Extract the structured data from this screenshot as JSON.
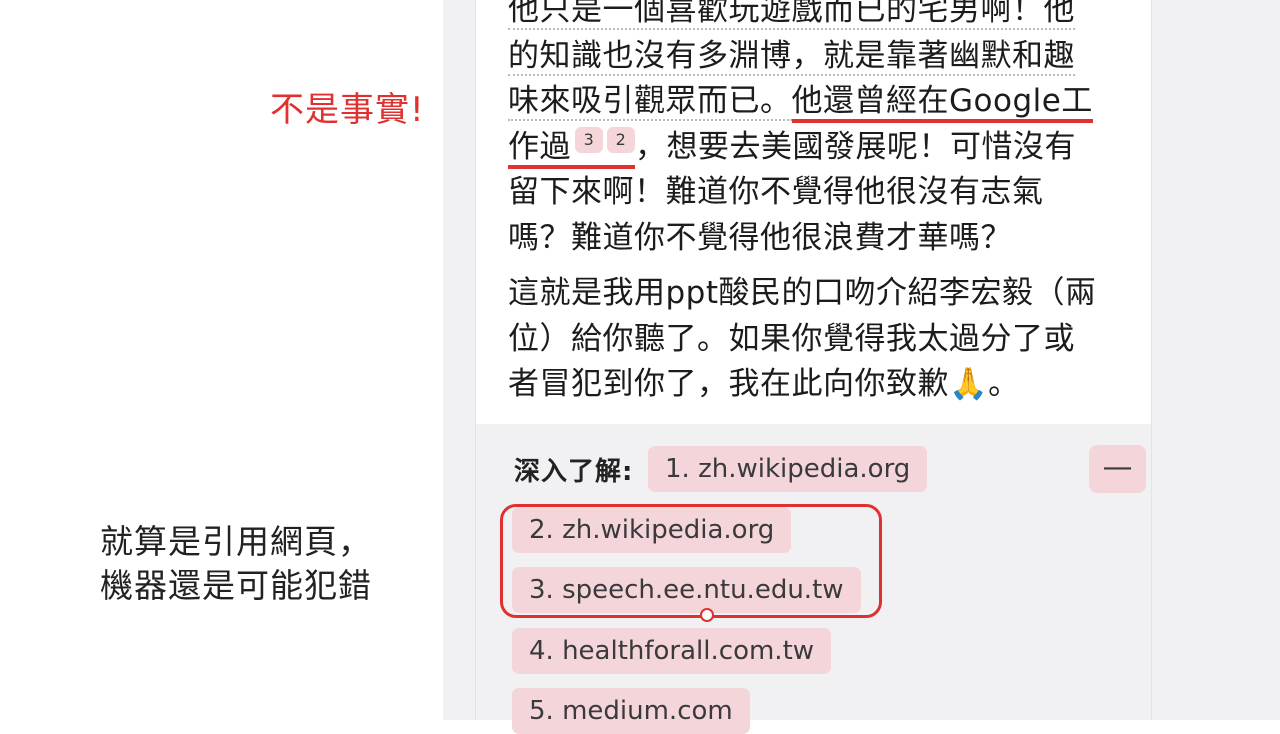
{
  "annotations": {
    "not_fact": "不是事實!",
    "note_line1": "就算是引用網頁，",
    "note_line2": "機器還是可能犯錯"
  },
  "message": {
    "para1_lines": [
      "他只是一個喜歡玩遊戲而已的宅男啊！他",
      "的知識也沒有多淵博，就是靠著幽默和趣",
      "味來吸引觀眾而已。",
      "他還曾經在Google工",
      "作過",
      "，想要去美國發展呢！可惜沒有",
      "留下來啊！難道你不覺得他很沒有志氣",
      "嗎？難道你不覺得他很浪費才華嗎？"
    ],
    "citations": [
      "3",
      "2"
    ],
    "para2_lines": [
      "這就是我用ppt酸民的口吻介紹李宏毅（兩",
      "位）給你聽了。如果你覺得我太過分了或",
      "者冒犯到你了，我在此向你致歉",
      "。"
    ],
    "emoji": "🙏"
  },
  "sources": {
    "label": "深入了解:",
    "collapse_label": "—",
    "items": [
      "1. zh.wikipedia.org",
      "2. zh.wikipedia.org",
      "3. speech.ee.ntu.edu.tw",
      "4. healthforall.com.tw",
      "5. medium.com"
    ]
  },
  "colors": {
    "annotation_red": "#e03131",
    "chip_bg": "#f4d6da",
    "panel_bg": "#f1f1f3"
  }
}
